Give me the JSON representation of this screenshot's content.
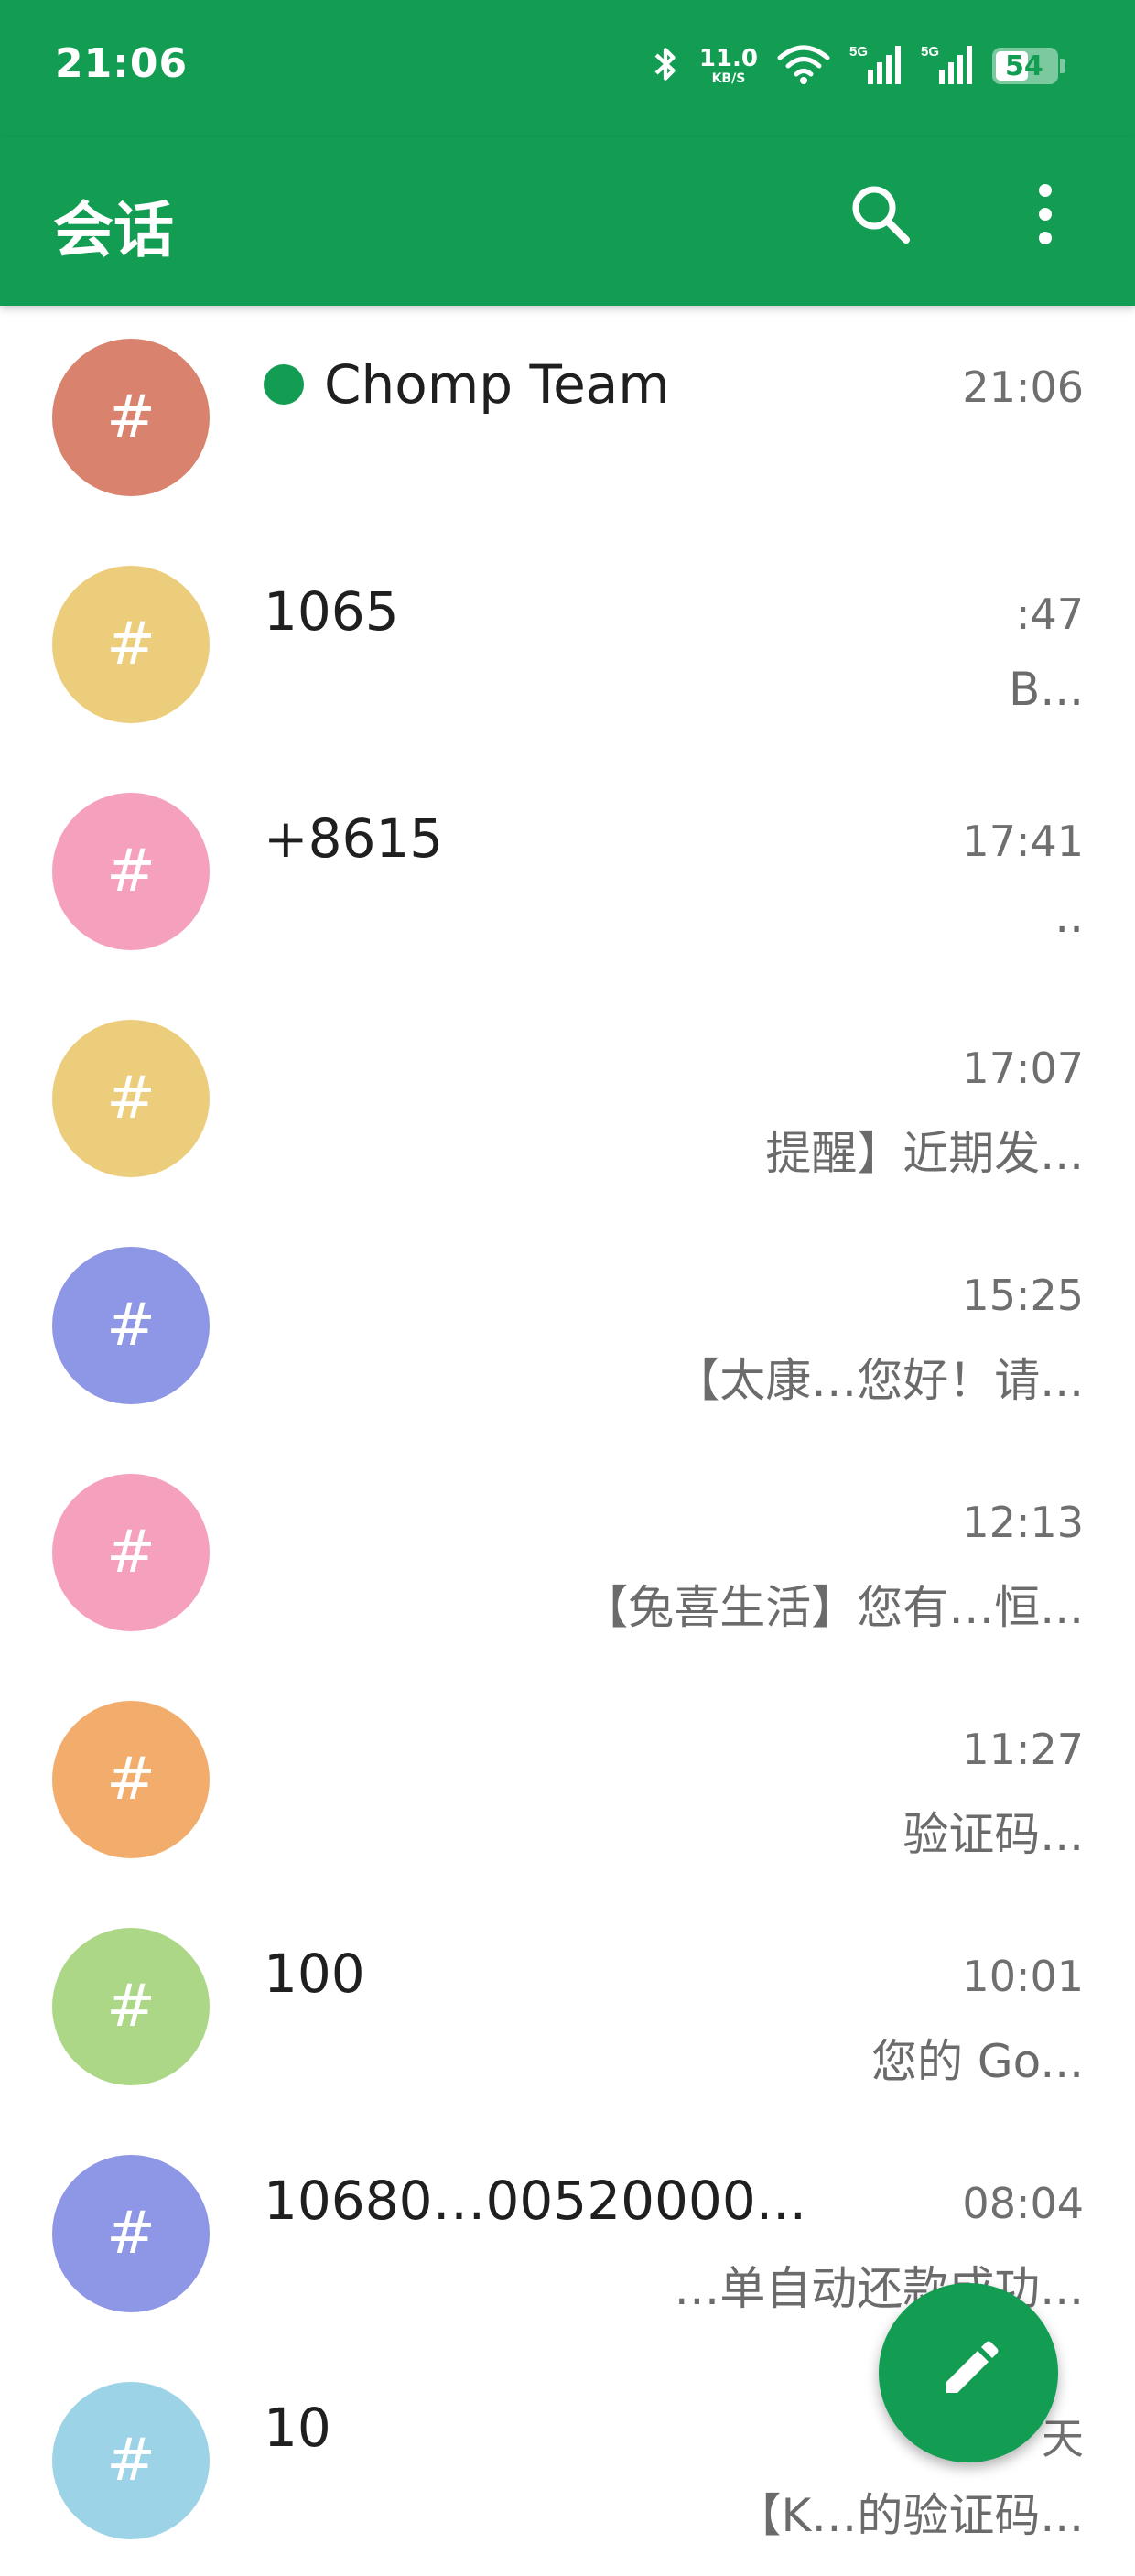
{
  "status_bar": {
    "time": "21:06",
    "net_speed": "11.0",
    "net_unit": "KB/S",
    "signal_1": "5G",
    "signal_2": "5G",
    "battery": "54",
    "battery_fraction": 0.54
  },
  "app_bar": {
    "title": "会话",
    "search_icon": "search-icon",
    "more_icon": "more-vertical-icon"
  },
  "colors": {
    "primary": "#129d53",
    "avatar_palette": [
      "#d9836f",
      "#eccd7c",
      "#f5a0bc",
      "#eccd7c",
      "#8e97e6",
      "#f5a0bc",
      "#f2ad6c",
      "#acd786",
      "#8e97e6",
      "#9cd3e6"
    ]
  },
  "conversations": [
    {
      "avatar": "#",
      "name": "Chomp Team",
      "online": true,
      "time": "21:06",
      "preview": ""
    },
    {
      "avatar": "#",
      "name": "1065",
      "online": false,
      "time": ":47",
      "preview": "B..."
    },
    {
      "avatar": "#",
      "name": "+8615",
      "online": false,
      "time": "17:41",
      "preview": ".."
    },
    {
      "avatar": "#",
      "name": "",
      "online": false,
      "time": "17:07",
      "preview": "提醒】近期发..."
    },
    {
      "avatar": "#",
      "name": "",
      "online": false,
      "time": "15:25",
      "preview": "【太康…您好！请..."
    },
    {
      "avatar": "#",
      "name": "",
      "online": false,
      "time": "12:13",
      "preview": "【兔喜生活】您有…恒..."
    },
    {
      "avatar": "#",
      "name": "",
      "online": false,
      "time": "11:27",
      "preview": "验证码..."
    },
    {
      "avatar": "#",
      "name": "100",
      "online": false,
      "time": "10:01",
      "preview": "您的 Go..."
    },
    {
      "avatar": "#",
      "name": "10680…00520000...",
      "online": false,
      "time": "08:04",
      "preview": "…单自动还款成功..."
    },
    {
      "avatar": "#",
      "name": "10",
      "online": false,
      "time": "天",
      "preview": "【K…的验证码..."
    }
  ],
  "fab": {
    "icon": "pencil-icon"
  }
}
